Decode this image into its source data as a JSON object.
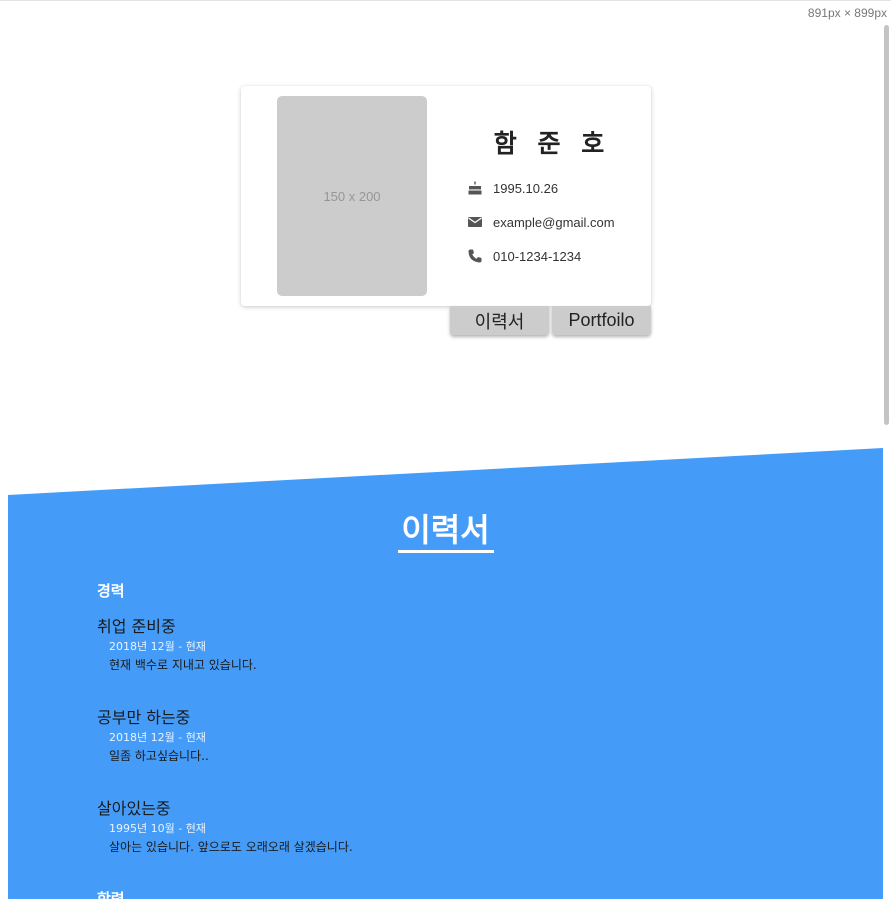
{
  "viewport_label": "891px × 899px",
  "profile": {
    "photo_placeholder": "150 x 200",
    "name": "함 준 호",
    "birthdate": "1995.10.26",
    "email": "example@gmail.com",
    "phone": "010-1234-1234"
  },
  "tabs": [
    {
      "label": "이력서"
    },
    {
      "label": "Portfoilo"
    }
  ],
  "resume": {
    "title": "이력서",
    "career_heading": "경력",
    "education_heading": "학력",
    "items": [
      {
        "title": "취업 준비중",
        "period": "2018년 12월 - 현재",
        "description": "현재 백수로 지내고 있습니다."
      },
      {
        "title": "공부만 하는중",
        "period": "2018년 12월 - 현재",
        "description": "일좀 하고싶습니다.."
      },
      {
        "title": "살아있는중",
        "period": "1995년 10월 - 현재",
        "description": "살아는 있습니다. 앞으로도 오래오래 살겠습니다."
      }
    ]
  },
  "colors": {
    "accent": "#449cf8",
    "placeholder": "#cccccc",
    "tab": "#cccccc"
  },
  "icons": {
    "birth": "cake-icon",
    "email": "mail-icon",
    "phone": "phone-icon"
  }
}
